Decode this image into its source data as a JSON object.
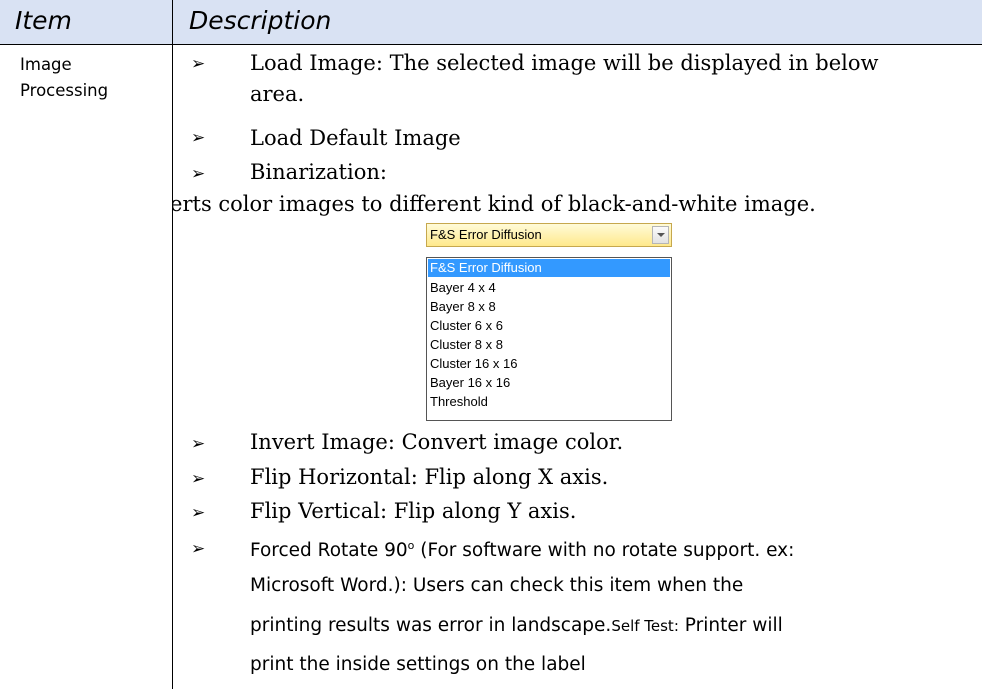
{
  "header": {
    "item": "Item",
    "description": "Description"
  },
  "item_cell": {
    "line1": "Image",
    "line2": "Processing"
  },
  "bullets": {
    "load_image": "Load Image: The selected image will be displayed in below",
    "load_image_cont": "area.",
    "load_default": "Load Default Image",
    "binarization": "Binarization:",
    "binarization_desc": "rerts color images to different kind of black-and-white image.",
    "invert": "Invert Image: Convert image color.",
    "flip_h": "Flip Horizontal: Flip along X axis.",
    "flip_v": "Flip Vertical: Flip along Y axis.",
    "forced_rotate_prefix": "Forced Rotate 90",
    "forced_rotate_sup": "o",
    "forced_rotate_suffix": " (For software with no rotate support. ex:",
    "forced_line2": "Microsoft Word.): Users can check this item when the",
    "forced_line3a": "printing results was error in landscape.",
    "self_test": "Self Test",
    "colon": ":",
    "forced_line3b": " Printer will",
    "forced_line4": "print the inside settings on the label"
  },
  "dropdown": {
    "selected": "F&S Error Diffusion",
    "options": [
      "F&S Error Diffusion",
      "Bayer 4 x 4",
      "Bayer 8 x 8",
      "Cluster 6 x 6",
      "Cluster 8 x 8",
      "Cluster 16 x 16",
      "Bayer 16 x 16",
      "Threshold"
    ]
  },
  "bullet_glyph": "➢",
  "colors": {
    "header_bg": "#d9e2f3",
    "selection": "#3399ff",
    "dropdown_border": "#c6a84e"
  }
}
